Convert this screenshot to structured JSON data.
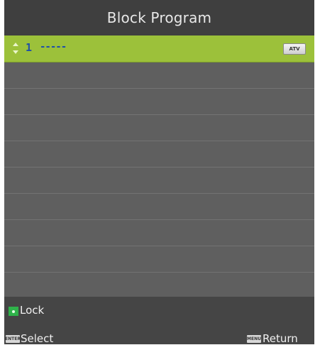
{
  "title": "Block Program",
  "colors": {
    "selected_row": "#9cc13a",
    "lock_key": "#2fb24a",
    "program_text": "#1f4fa8"
  },
  "programs": [
    {
      "number": "1",
      "name": "-----",
      "type": "ATV",
      "selected": true
    }
  ],
  "footer": {
    "lock_label": "Lock",
    "enter_key": "ENTER",
    "select_label": "Select",
    "menu_key": "MENU",
    "return_label": "Return"
  },
  "icons": {
    "updown": "up-down-arrows-icon",
    "lock": "green-key-icon",
    "enter": "enter-key-icon",
    "menu": "menu-key-icon"
  }
}
